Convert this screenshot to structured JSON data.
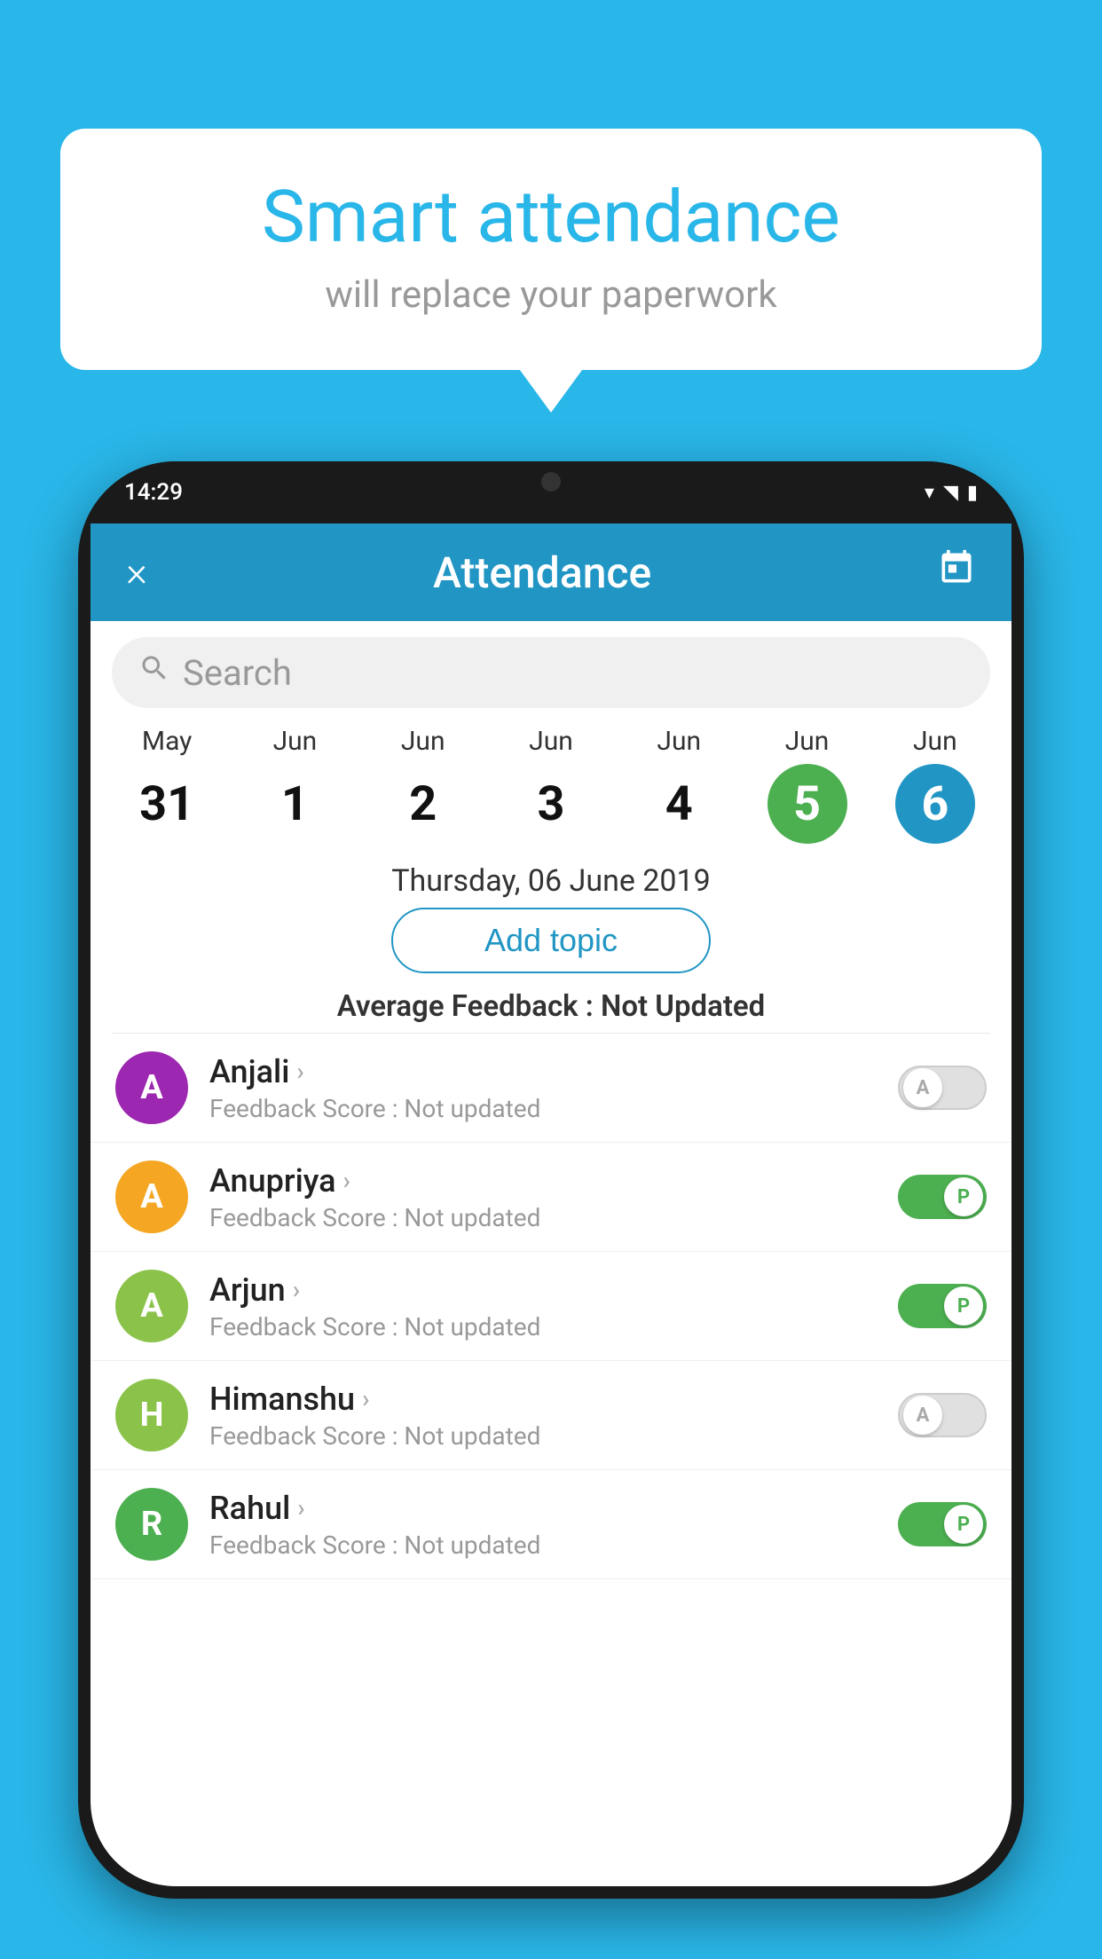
{
  "background_color": "#29b6e8",
  "speech_bubble": {
    "title": "Smart attendance",
    "subtitle": "will replace your paperwork"
  },
  "phone": {
    "status_bar": {
      "time": "14:29",
      "wifi_icon": "▾",
      "signal_icon": "▲",
      "battery_icon": "▮"
    },
    "header": {
      "close_label": "×",
      "title": "Attendance",
      "calendar_icon": "📅"
    },
    "search": {
      "placeholder": "Search"
    },
    "dates": [
      {
        "month": "May",
        "day": "31",
        "style": "normal"
      },
      {
        "month": "Jun",
        "day": "1",
        "style": "normal"
      },
      {
        "month": "Jun",
        "day": "2",
        "style": "normal"
      },
      {
        "month": "Jun",
        "day": "3",
        "style": "normal"
      },
      {
        "month": "Jun",
        "day": "4",
        "style": "normal"
      },
      {
        "month": "Jun",
        "day": "5",
        "style": "green"
      },
      {
        "month": "Jun",
        "day": "6",
        "style": "blue"
      }
    ],
    "selected_date": "Thursday, 06 June 2019",
    "add_topic_label": "Add topic",
    "avg_feedback_label": "Average Feedback :",
    "avg_feedback_value": "Not Updated",
    "students": [
      {
        "name": "Anjali",
        "avatar_letter": "A",
        "avatar_color": "#9c27b0",
        "feedback_label": "Feedback Score :",
        "feedback_value": "Not updated",
        "toggle_state": "off",
        "toggle_letter": "A"
      },
      {
        "name": "Anupriya",
        "avatar_letter": "A",
        "avatar_color": "#f5a623",
        "feedback_label": "Feedback Score :",
        "feedback_value": "Not updated",
        "toggle_state": "on",
        "toggle_letter": "P"
      },
      {
        "name": "Arjun",
        "avatar_letter": "A",
        "avatar_color": "#8bc34a",
        "feedback_label": "Feedback Score :",
        "feedback_value": "Not updated",
        "toggle_state": "on",
        "toggle_letter": "P"
      },
      {
        "name": "Himanshu",
        "avatar_letter": "H",
        "avatar_color": "#8bc34a",
        "feedback_label": "Feedback Score :",
        "feedback_value": "Not updated",
        "toggle_state": "off",
        "toggle_letter": "A"
      },
      {
        "name": "Rahul",
        "avatar_letter": "R",
        "avatar_color": "#4caf50",
        "feedback_label": "Feedback Score :",
        "feedback_value": "Not updated",
        "toggle_state": "on",
        "toggle_letter": "P"
      }
    ]
  }
}
